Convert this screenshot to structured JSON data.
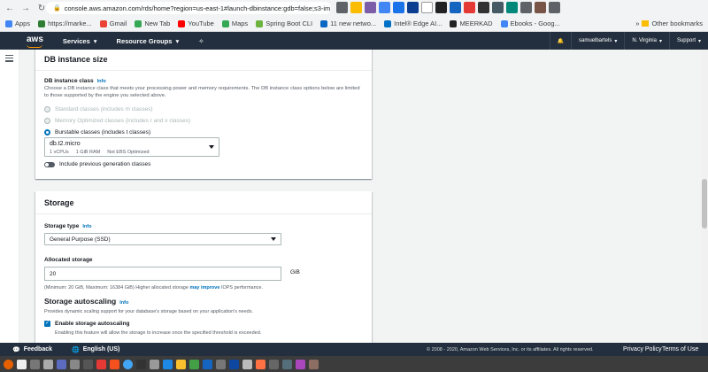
{
  "browser": {
    "url": "console.aws.amazon.com/rds/home?region=us-east-1#launch-dbinstance:gdb=false;s3-im...",
    "bookmarks": [
      "Apps",
      "https://marke...",
      "Gmail",
      "New Tab",
      "YouTube",
      "Maps",
      "Spring Boot CLI",
      "11 new netwo...",
      "Intel® Edge AI...",
      "MEERKAD",
      "Ebooks - Goog..."
    ],
    "other_bookmarks": "Other bookmarks"
  },
  "awsnav": {
    "logo": "aws",
    "services": "Services",
    "resource_groups": "Resource Groups",
    "user": "samuelbartels",
    "region": "N. Virginia",
    "support": "Support"
  },
  "instance_size": {
    "title": "DB instance size",
    "class_label": "DB instance class",
    "info": "Info",
    "class_desc": "Choose a DB instance class that meets your processing power and memory requirements. The DB instance class options below are limited to those supported by the engine you selected above.",
    "options": [
      {
        "label": "Standard classes (includes m classes)",
        "checked": false,
        "disabled": true
      },
      {
        "label": "Memory Optimized classes (includes r and x classes)",
        "checked": false,
        "disabled": true
      },
      {
        "label": "Burstable classes (includes t classes)",
        "checked": true,
        "disabled": false
      }
    ],
    "selected_class": "db.t2.micro",
    "class_specs": [
      "1 vCPUs",
      "1 GiB RAM",
      "Not EBS Optimized"
    ],
    "prev_gen_label": "Include previous generation classes"
  },
  "storage": {
    "title": "Storage",
    "type_label": "Storage type",
    "info": "Info",
    "type_value": "General Purpose (SSD)",
    "alloc_label": "Allocated storage",
    "alloc_value": "20",
    "alloc_unit": "GiB",
    "alloc_hint_pre": "(Minimum: 20 GiB, Maximum: 16384 GiB) Higher allocated storage ",
    "alloc_hint_link": "may improve",
    "alloc_hint_post": " IOPS performance.",
    "autoscaling_title": "Storage autoscaling",
    "autoscaling_info": "Info",
    "autoscaling_desc": "Provides dynamic scaling support for your database's storage based on your application's needs.",
    "enable_label": "Enable storage autoscaling",
    "enable_desc": "Enabling this feature will allow the storage to increase once the specified threshold is exceeded."
  },
  "footer": {
    "feedback": "Feedback",
    "language": "English (US)",
    "copyright": "© 2008 - 2020, Amazon Web Services, Inc. or its affiliates. All rights reserved.",
    "privacy": "Privacy Policy",
    "terms": "Terms of Use"
  },
  "colors": {
    "aws_nav": "#232f3e",
    "aws_orange": "#ff9900",
    "link_blue": "#0073bb"
  }
}
